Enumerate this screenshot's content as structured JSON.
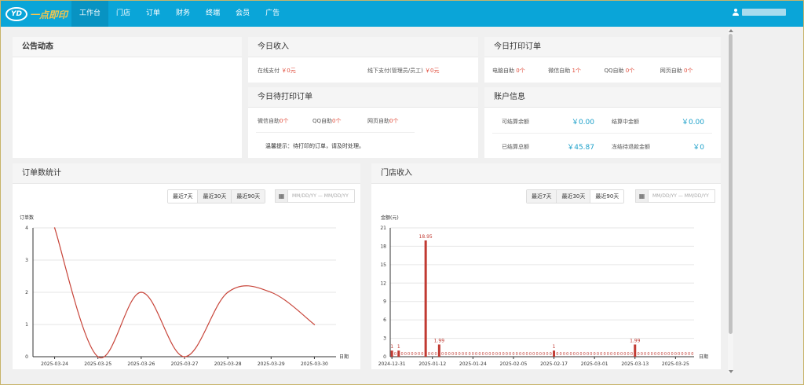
{
  "brand": {
    "badge": "YD",
    "name": "一点即印"
  },
  "nav": [
    {
      "label": "工作台",
      "active": true
    },
    {
      "label": "门店"
    },
    {
      "label": "订单"
    },
    {
      "label": "财务"
    },
    {
      "label": "终端"
    },
    {
      "label": "会员"
    },
    {
      "label": "广告"
    }
  ],
  "announcement": {
    "title": "公告动态"
  },
  "today_income": {
    "title": "今日收入",
    "online_label": "在线支付",
    "online_value": "￥0元",
    "offline_label": "线下支付(管理员/员工)",
    "offline_value": "￥0元"
  },
  "today_print_orders": {
    "title": "今日打印订单",
    "items": [
      {
        "label": "电脑自助",
        "value": "0个"
      },
      {
        "label": "微信自助",
        "value": "1个"
      },
      {
        "label": "QQ自助",
        "value": "0个"
      },
      {
        "label": "网页自助",
        "value": "0个"
      }
    ]
  },
  "pending_orders": {
    "title": "今日待打印订单",
    "items": [
      {
        "label": "微信自助",
        "value": "0个"
      },
      {
        "label": "QQ自助",
        "value": "0个"
      },
      {
        "label": "网页自助",
        "value": "0个"
      }
    ],
    "tip": "温馨提示：待打印的订单，请及时处理。"
  },
  "account": {
    "title": "账户信息",
    "available_label": "可结算余额",
    "available_value": "￥0.00",
    "settling_label": "结算中金额",
    "settling_value": "￥0.00",
    "settled_label": "已结算总额",
    "settled_value": "￥45.87",
    "frozen_label": "冻结待退款金额",
    "frozen_value": "￥0"
  },
  "orders_panel": {
    "title": "订单数统计",
    "ranges": [
      "最近7天",
      "最近30天",
      "最近90天"
    ],
    "active_range": 0,
    "date_placeholder": "MM/DD/YY — MM/DD/YY",
    "calendar_icon": "calendar-icon"
  },
  "income_panel": {
    "title": "门店收入",
    "ranges": [
      "最近7天",
      "最近30天",
      "最近90天"
    ],
    "active_range": 2,
    "date_placeholder": "MM/DD/YY — MM/DD/YY",
    "calendar_icon": "calendar-icon"
  },
  "chart_data": [
    {
      "type": "line",
      "ylabel": "订单数",
      "xlabel": "日期",
      "categories": [
        "2025-03-24",
        "2025-03-25",
        "2025-03-26",
        "2025-03-27",
        "2025-03-28",
        "2025-03-29",
        "2025-03-30"
      ],
      "values": [
        4,
        0,
        2,
        0,
        2,
        2,
        1
      ],
      "ylim": [
        0,
        4
      ],
      "yticks": [
        0,
        1,
        2,
        3,
        4
      ],
      "color": "#c8463b",
      "grid": true
    },
    {
      "type": "bar",
      "ylabel": "金额(元)",
      "xlabel": "日期",
      "x_start": "2024-12-31",
      "x_tick_labels": [
        "2024-12-31",
        "2025-01-12",
        "2025-01-24",
        "2025-02-05",
        "2025-02-17",
        "2025-03-01",
        "2025-03-13",
        "2025-03-25"
      ],
      "day_count": 90,
      "bars": [
        {
          "day": 0,
          "value": 1,
          "label": "1"
        },
        {
          "day": 2,
          "value": 1,
          "label": "1"
        },
        {
          "day": 10,
          "value": 18.95,
          "label": "18.95"
        },
        {
          "day": 14,
          "value": 1.99,
          "label": "1.99"
        },
        {
          "day": 48,
          "value": 1,
          "label": "1"
        },
        {
          "day": 72,
          "value": 1.99,
          "label": "1.99"
        }
      ],
      "ylim": [
        0,
        21
      ],
      "yticks": [
        0,
        3,
        6,
        9,
        12,
        15,
        18,
        21
      ],
      "color": "#c13a32",
      "grid": true
    }
  ]
}
